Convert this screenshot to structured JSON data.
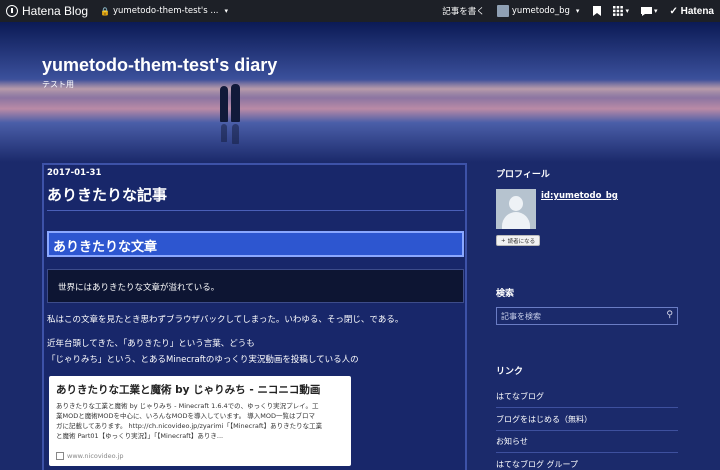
{
  "topbar": {
    "logo": "Hatena Blog",
    "blog_selector": "yumetodo-them-test's ...",
    "write_label": "記事を書く",
    "user": "yumetodo_bg",
    "hatena_label": "Hatena",
    "icons": [
      "bookmark-icon",
      "apps-grid-icon",
      "notification-icon"
    ]
  },
  "header": {
    "title": "yumetodo-them-test's diary",
    "description": "テスト用"
  },
  "article": {
    "date": "2017-01-31",
    "title": "ありきたりな記事",
    "h2": "ありきたりな文章",
    "quote": "世界にはありきたりな文章が溢れている。",
    "para1": "私はこの文章を見たとき思わずブラウザバックしてしまった。いわゆる、そっ閉じ、である。",
    "para2_line1": "近年台頭してきた、「ありきたり」という言葉、どうも",
    "para2_line2": "「じゃりみち」という、とあるMinecraftのゆっくり実況動画を投稿している人の",
    "embed": {
      "title": "ありきたりな工業と魔術 by じゃりみち - ニコニコ動画",
      "desc_line1": "ありきたりな工業と魔術 by じゃりみち - Minecraft 1.6.4での、ゆっくり実況プレイ。工",
      "desc_line2": "業MODと魔術MODを中心に、いろんなMODを導入しています。 導入MOD一覧はブロマ",
      "desc_line3": "ガに記載してあります。 http://ch.nicovideo.jp/zyarimi「【Minecraft】ありきたりな工業",
      "desc_line4": "と魔術 Part01【ゆっくり実況】」「【Minecraft】ありき...",
      "site": "www.nicovideo.jp"
    }
  },
  "sidebar": {
    "profile_heading": "プロフィール",
    "profile_id": "id:yumetodo_bg",
    "follow_label": "読者になる",
    "search_heading": "検索",
    "search_placeholder": "記事を検索",
    "links_heading": "リンク",
    "links": [
      "はてなブログ",
      "ブログをはじめる（無料）",
      "お知らせ",
      "はてなブログ グループ"
    ]
  }
}
